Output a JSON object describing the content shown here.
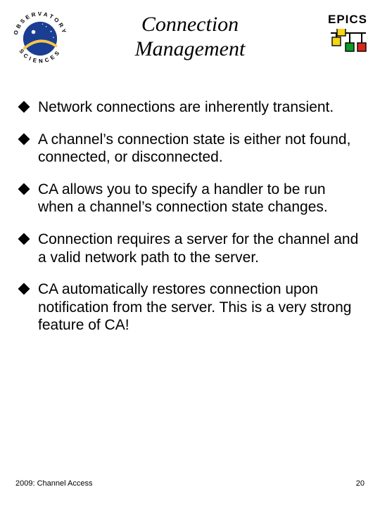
{
  "header": {
    "title_line1": "Connection",
    "title_line2": "Management",
    "epics_label": "EPICS"
  },
  "logo": {
    "obs_name": "observatory-sciences-logo",
    "epics_name": "epics-icon"
  },
  "bullets": [
    "Network connections are inherently transient.",
    "A channel’s connection state is either not found, connected, or disconnected.",
    "CA allows you to specify a handler to be run when a channel’s connection state changes.",
    "Connection requires a server for the channel and a valid network path to the server.",
    "CA automatically restores connection upon notification from the server. This is a very strong feature of CA!"
  ],
  "footer": {
    "left": "2009: Channel Access",
    "right": "20"
  },
  "colors": {
    "obs_blue": "#1b3e93",
    "obs_yellow": "#f7c948",
    "epics_yellow": "#f5d516",
    "epics_green": "#0a9b22",
    "epics_red": "#d9261c"
  }
}
